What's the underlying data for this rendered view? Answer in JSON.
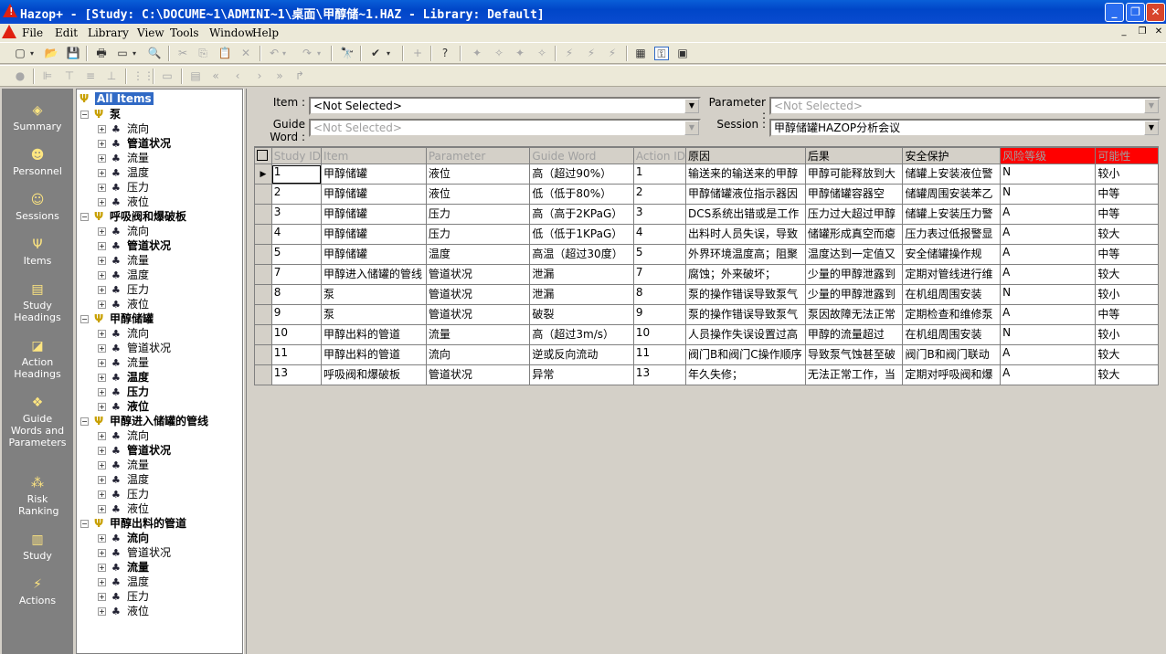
{
  "window": {
    "title": "Hazop+ - [Study: C:\\DOCUME~1\\ADMINI~1\\桌面\\甲醇储~1.HAZ - Library: Default]"
  },
  "menu": [
    "File",
    "Edit",
    "Library",
    "View",
    "Tools",
    "Window",
    "Help"
  ],
  "sidebar": [
    {
      "label": "Summary",
      "icon": "summary-icon"
    },
    {
      "label": "Personnel",
      "icon": "personnel-icon"
    },
    {
      "label": "Sessions",
      "icon": "sessions-icon"
    },
    {
      "label": "Items",
      "icon": "items-icon"
    },
    {
      "label": "Study Headings",
      "icon": "study-headings-icon"
    },
    {
      "label": "Action Headings",
      "icon": "action-headings-icon"
    },
    {
      "label": "Guide Words and Parameters",
      "icon": "guide-words-icon"
    },
    {
      "label": "Risk Ranking",
      "icon": "risk-ranking-icon"
    },
    {
      "label": "Study",
      "icon": "study-icon"
    },
    {
      "label": "Actions",
      "icon": "actions-icon"
    }
  ],
  "tree": {
    "root": "All Items",
    "groups": [
      {
        "name": "泵",
        "children": [
          {
            "t": "流向",
            "b": false
          },
          {
            "t": "管道状况",
            "b": true
          },
          {
            "t": "流量",
            "b": false
          },
          {
            "t": "温度",
            "b": false
          },
          {
            "t": "压力",
            "b": false
          },
          {
            "t": "液位",
            "b": false
          }
        ]
      },
      {
        "name": "呼吸阀和爆破板",
        "children": [
          {
            "t": "流向",
            "b": false
          },
          {
            "t": "管道状况",
            "b": true
          },
          {
            "t": "流量",
            "b": false
          },
          {
            "t": "温度",
            "b": false
          },
          {
            "t": "压力",
            "b": false
          },
          {
            "t": "液位",
            "b": false
          }
        ]
      },
      {
        "name": "甲醇储罐",
        "children": [
          {
            "t": "流向",
            "b": false
          },
          {
            "t": "管道状况",
            "b": false
          },
          {
            "t": "流量",
            "b": false
          },
          {
            "t": "温度",
            "b": true
          },
          {
            "t": "压力",
            "b": true
          },
          {
            "t": "液位",
            "b": true
          }
        ]
      },
      {
        "name": "甲醇进入储罐的管线",
        "children": [
          {
            "t": "流向",
            "b": false
          },
          {
            "t": "管道状况",
            "b": true
          },
          {
            "t": "流量",
            "b": false
          },
          {
            "t": "温度",
            "b": false
          },
          {
            "t": "压力",
            "b": false
          },
          {
            "t": "液位",
            "b": false
          }
        ]
      },
      {
        "name": "甲醇出料的管道",
        "children": [
          {
            "t": "流向",
            "b": true
          },
          {
            "t": "管道状况",
            "b": false
          },
          {
            "t": "流量",
            "b": true
          },
          {
            "t": "温度",
            "b": false
          },
          {
            "t": "压力",
            "b": false
          },
          {
            "t": "液位",
            "b": false
          }
        ]
      }
    ]
  },
  "filters": {
    "item_label": "Item :",
    "item_value": "<Not Selected>",
    "guide_label": "Guide Word :",
    "guide_value": "<Not Selected>",
    "parameter_label": "Parameter :",
    "parameter_value": "<Not Selected>",
    "session_label": "Session :",
    "session_value": "甲醇储罐HAZOP分析会议"
  },
  "grid": {
    "columns": [
      "Study ID",
      "Item",
      "Parameter",
      "Guide Word",
      "Action ID",
      "原因",
      "后果",
      "安全保护",
      "风险等级",
      "可能性"
    ],
    "rows": [
      [
        "1",
        "甲醇储罐",
        "液位",
        "高（超过90%）",
        "1",
        "输送来的输送来的甲醇",
        "甲醇可能释放到大",
        "储罐上安装液位警",
        "N",
        "较小"
      ],
      [
        "2",
        "甲醇储罐",
        "液位",
        "低（低于80%）",
        "2",
        "甲醇储罐液位指示器因",
        "甲醇储罐容器空",
        "储罐周围安装苯乙",
        "N",
        "中等"
      ],
      [
        "3",
        "甲醇储罐",
        "压力",
        "高（高于2KPaG）",
        "3",
        "DCS系统出错或是工作",
        "压力过大超过甲醇",
        "储罐上安装压力警",
        "A",
        "中等"
      ],
      [
        "4",
        "甲醇储罐",
        "压力",
        "低（低于1KPaG）",
        "4",
        "出料时人员失误，导致",
        "储罐形成真空而瘪",
        "压力表过低报警显",
        "A",
        "较大"
      ],
      [
        "5",
        "甲醇储罐",
        "温度",
        "高温（超过30度）",
        "5",
        "外界环境温度高；阻聚",
        "温度达到一定值又",
        "安全储罐操作规",
        "A",
        "中等"
      ],
      [
        "7",
        "甲醇进入储罐的管线",
        "管道状况",
        "泄漏",
        "7",
        "腐蚀；外来破坏；",
        "少量的甲醇泄露到",
        "定期对管线进行维",
        "A",
        "较大"
      ],
      [
        "8",
        "泵",
        "管道状况",
        "泄漏",
        "8",
        "泵的操作错误导致泵气",
        "少量的甲醇泄露到",
        "在机组周围安装",
        "N",
        "较小"
      ],
      [
        "9",
        "泵",
        "管道状况",
        "破裂",
        "9",
        "泵的操作错误导致泵气",
        "泵因故障无法正常",
        "定期检查和维修泵",
        "A",
        "中等"
      ],
      [
        "10",
        "甲醇出料的管道",
        "流量",
        "高（超过3m/s）",
        "10",
        "人员操作失误设置过高",
        "甲醇的流量超过",
        "在机组周围安装",
        "N",
        "较小"
      ],
      [
        "11",
        "甲醇出料的管道",
        "流向",
        "逆或反向流动",
        "11",
        "阀门B和阀门C操作顺序",
        "导致泵气蚀甚至破",
        "阀门B和阀门联动",
        "A",
        "较大"
      ],
      [
        "13",
        "呼吸阀和爆破板",
        "管道状况",
        "异常",
        "13",
        "年久失修；",
        "无法正常工作，当",
        "定期对呼吸阀和爆",
        "A",
        "较大"
      ]
    ]
  },
  "colors": {
    "accent": "#316ac5",
    "risk_header": "#ff0000",
    "sidebar_bg": "#808080"
  }
}
